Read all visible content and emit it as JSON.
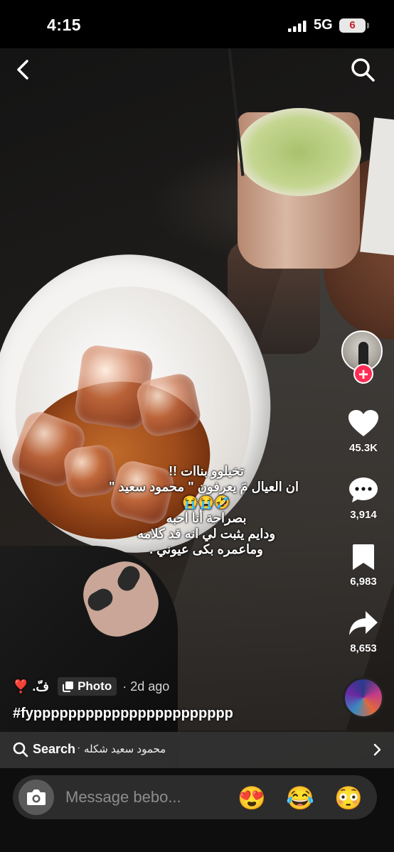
{
  "status_bar": {
    "time": "4:15",
    "network": "5G",
    "battery": "6"
  },
  "post": {
    "caption_lines": [
      "تخيلوو بناات !!",
      "ان العيال مَ يعرفون \" محمود سعيد \"",
      "🤣😭😭",
      "بصراحة أنا احبه",
      "ودايم يثبت لي انه قد كلامه",
      "وماعمره بكى عيوني ."
    ],
    "author": "فّ. ❣️",
    "type_badge": "Photo",
    "time": "· 2d ago",
    "hashtag": "#fyppppppppppppppppppppppp"
  },
  "actions": {
    "likes": "45.3K",
    "comments": "3,914",
    "saves": "6,983",
    "shares": "8,653"
  },
  "search_bar": {
    "label": "Search",
    "separator": "·",
    "query": "محمود سعيد شكله"
  },
  "message_bar": {
    "placeholder": "Message bebo...",
    "quick_emojis": [
      "😍",
      "😂",
      "😳"
    ]
  },
  "icons": {
    "back": "back-icon",
    "search": "search-icon",
    "like": "heart-icon",
    "comment": "comment-icon",
    "save": "bookmark-icon",
    "share": "share-icon",
    "camera": "camera-icon"
  },
  "colors": {
    "accent": "#fe2c55",
    "background": "#000000"
  }
}
